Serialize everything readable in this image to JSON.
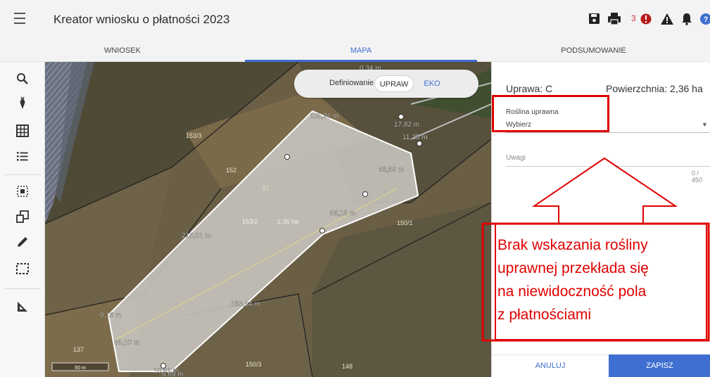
{
  "app": {
    "title": "Kreator wniosku o płatności 2023"
  },
  "toolbar": {
    "icons": [
      "menu-icon",
      "save-icon",
      "print-icon",
      "error-icon",
      "warning-icon",
      "bell-icon",
      "help-icon",
      "account-icon"
    ],
    "error_count": "3"
  },
  "tabs": [
    {
      "label": "WNIOSEK"
    },
    {
      "label": "MAPA"
    },
    {
      "label": "PODSUMOWANIE"
    }
  ],
  "rail": {
    "icons": [
      "search-icon",
      "plant-icon",
      "grid-icon",
      "list-icon",
      "select-area-icon",
      "copy-shapes-icon",
      "pencil-icon",
      "frame-icon",
      "measure-icon"
    ]
  },
  "toggle": {
    "label": "Definiowanie",
    "options": [
      "UPRAW",
      "EKO"
    ],
    "selected": "UPRAW"
  },
  "map": {
    "parcel_labels": [
      "153/3",
      "152",
      "37",
      "150/1",
      "137",
      "150/3",
      "148",
      "153/2",
      "2,36 ha"
    ],
    "measure_labels": [
      "0,34 m",
      "105,91 m",
      "17,82 m",
      "11,35 m",
      "68,59 m",
      "56,15 m",
      "213,01 m",
      "183,54 m",
      "0,16 m",
      "65,10 m",
      "10,61 m",
      "6,69 m"
    ],
    "scale": "50 m"
  },
  "panel": {
    "uprawa": "Uprawa: C",
    "area": "Powierzchnia: 2,36 ha",
    "crop_label": "Roślina uprawna",
    "crop_value": "Wybierz",
    "notes_label": "Uwagi",
    "notes_count": "0 / 450",
    "cancel": "ANULUJ",
    "save": "ZAPISZ"
  },
  "annotation": {
    "lines": [
      "Brak wskazania rośliny",
      "uprawnej przekłada się",
      "na niewidoczność pola",
      "z płatnościami"
    ]
  },
  "colors": {
    "accent": "#3f6fd0",
    "annotation": "#e00000",
    "error": "#d32f2f"
  }
}
